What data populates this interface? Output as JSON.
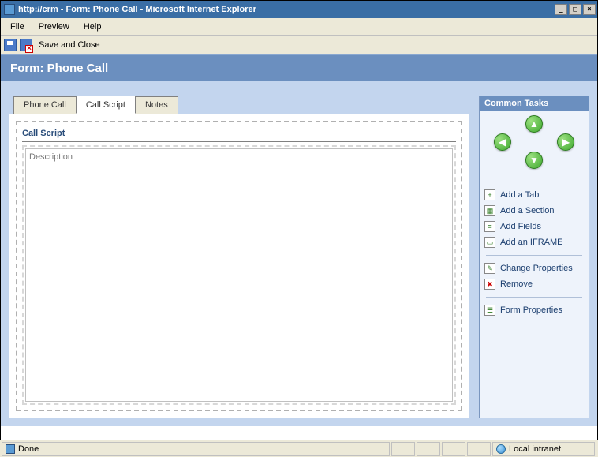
{
  "window": {
    "title": "http://crm - Form: Phone Call - Microsoft Internet Explorer"
  },
  "menu": {
    "file": "File",
    "preview": "Preview",
    "help": "Help"
  },
  "toolbar": {
    "save_and_close": "Save and Close"
  },
  "header": {
    "title": "Form: Phone Call"
  },
  "tabs": [
    {
      "label": "Phone Call"
    },
    {
      "label": "Call Script"
    },
    {
      "label": "Notes"
    }
  ],
  "active_tab_index": 1,
  "section": {
    "title": "Call Script",
    "field_placeholder": "Description"
  },
  "sidebar": {
    "header": "Common Tasks",
    "groups": [
      [
        {
          "label": "Add a Tab",
          "icon": "+"
        },
        {
          "label": "Add a Section",
          "icon": "▦"
        },
        {
          "label": "Add Fields",
          "icon": "≡"
        },
        {
          "label": "Add an IFRAME",
          "icon": "▭"
        }
      ],
      [
        {
          "label": "Change Properties",
          "icon": "✎"
        },
        {
          "label": "Remove",
          "icon": "✖"
        }
      ],
      [
        {
          "label": "Form Properties",
          "icon": "☰"
        }
      ]
    ]
  },
  "statusbar": {
    "message": "Done",
    "zone": "Local intranet"
  }
}
